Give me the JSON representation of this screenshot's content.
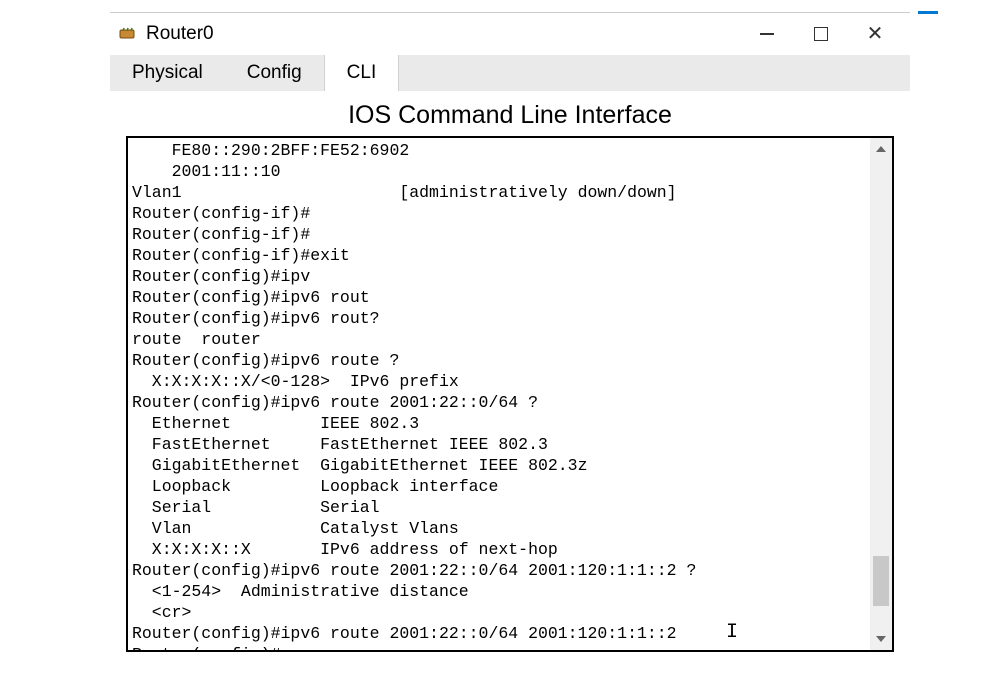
{
  "window": {
    "title": "Router0"
  },
  "tabs": {
    "physical": "Physical",
    "config": "Config",
    "cli": "CLI"
  },
  "cli": {
    "heading": "IOS Command Line Interface",
    "lines": [
      "    FE80::290:2BFF:FE52:6902",
      "    2001:11::10",
      "Vlan1                      [administratively down/down]",
      "Router(config-if)#",
      "Router(config-if)#",
      "Router(config-if)#exit",
      "Router(config)#ipv",
      "Router(config)#ipv6 rout",
      "Router(config)#ipv6 rout?",
      "route  router",
      "Router(config)#ipv6 route ?",
      "  X:X:X:X::X/<0-128>  IPv6 prefix",
      "Router(config)#ipv6 route 2001:22::0/64 ?",
      "  Ethernet         IEEE 802.3",
      "  FastEthernet     FastEthernet IEEE 802.3",
      "  GigabitEthernet  GigabitEthernet IEEE 802.3z",
      "  Loopback         Loopback interface",
      "  Serial           Serial",
      "  Vlan             Catalyst Vlans",
      "  X:X:X:X::X       IPv6 address of next-hop",
      "Router(config)#ipv6 route 2001:22::0/64 2001:120:1:1::2 ?",
      "  <1-254>  Administrative distance",
      "  <cr>",
      "Router(config)#ipv6 route 2001:22::0/64 2001:120:1:1::2",
      "Router(config)#"
    ]
  }
}
